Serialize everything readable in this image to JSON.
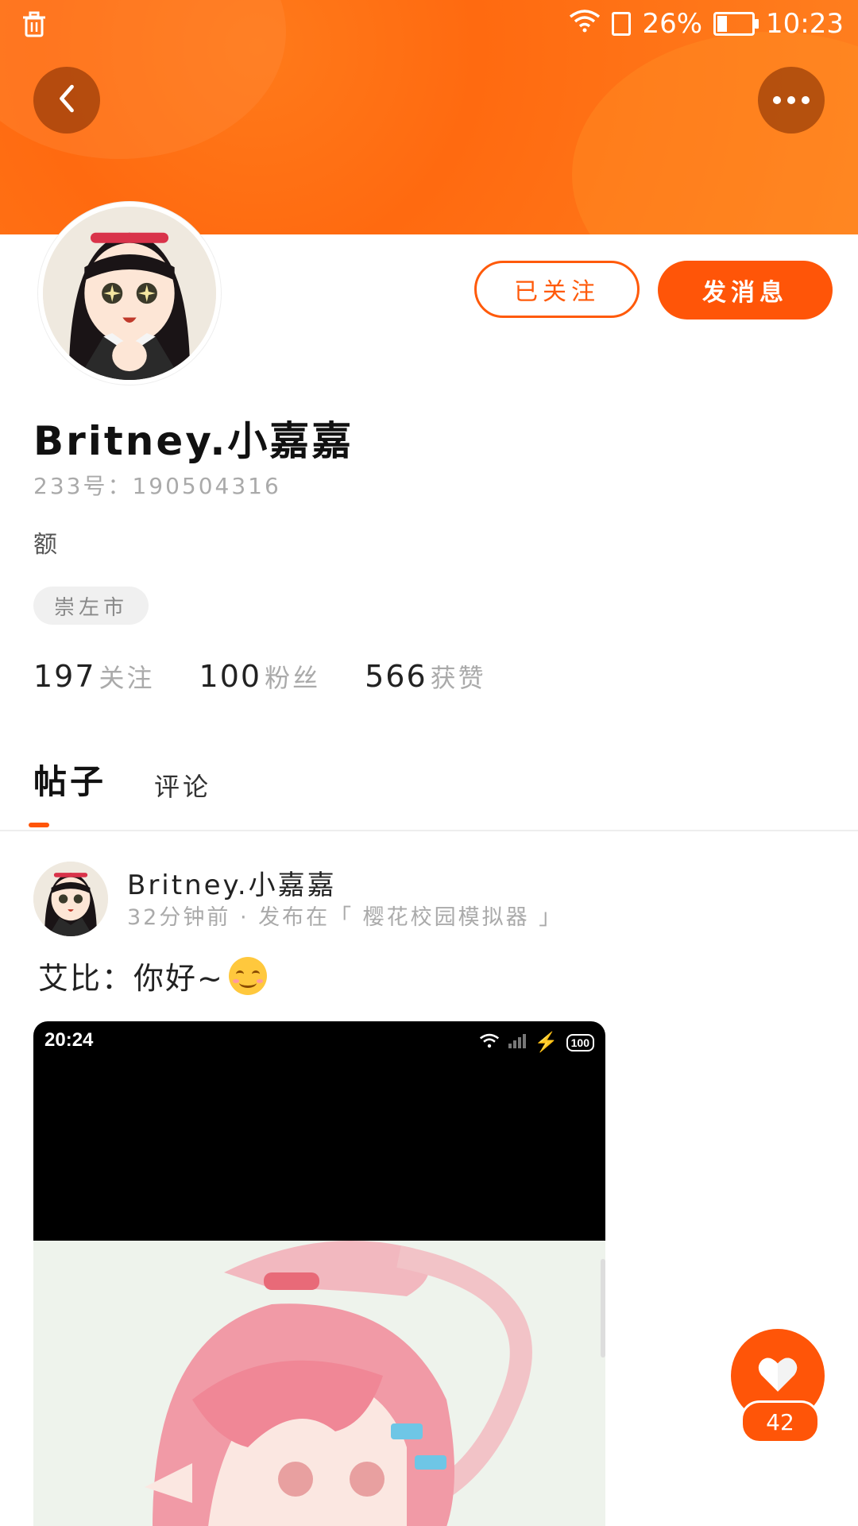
{
  "status_bar": {
    "battery_percent": "26%",
    "battery_level": 0.26,
    "time": "10:23"
  },
  "profile": {
    "username": "Britney.小嘉嘉",
    "user_id": "233号：190504316",
    "bio": "额",
    "location": "崇左市",
    "follow_state_label": "已关注",
    "message_label": "发消息",
    "stats": [
      {
        "value": "197",
        "label": "关注"
      },
      {
        "value": "100",
        "label": "粉丝"
      },
      {
        "value": "566",
        "label": "获赞"
      }
    ]
  },
  "tabs": [
    {
      "label": "帖子",
      "active": true
    },
    {
      "label": "评论",
      "active": false
    }
  ],
  "post": {
    "author": "Britney.小嘉嘉",
    "meta": "32分钟前 · 发布在「 樱花校园模拟器 」",
    "text": "艾比：你好~",
    "emoji": "smiling-face",
    "image_status": {
      "time": "20:24",
      "battery": "100"
    }
  },
  "like": {
    "count": "42"
  },
  "colors": {
    "accent": "#ff5508",
    "header": "#ff7a1a"
  }
}
